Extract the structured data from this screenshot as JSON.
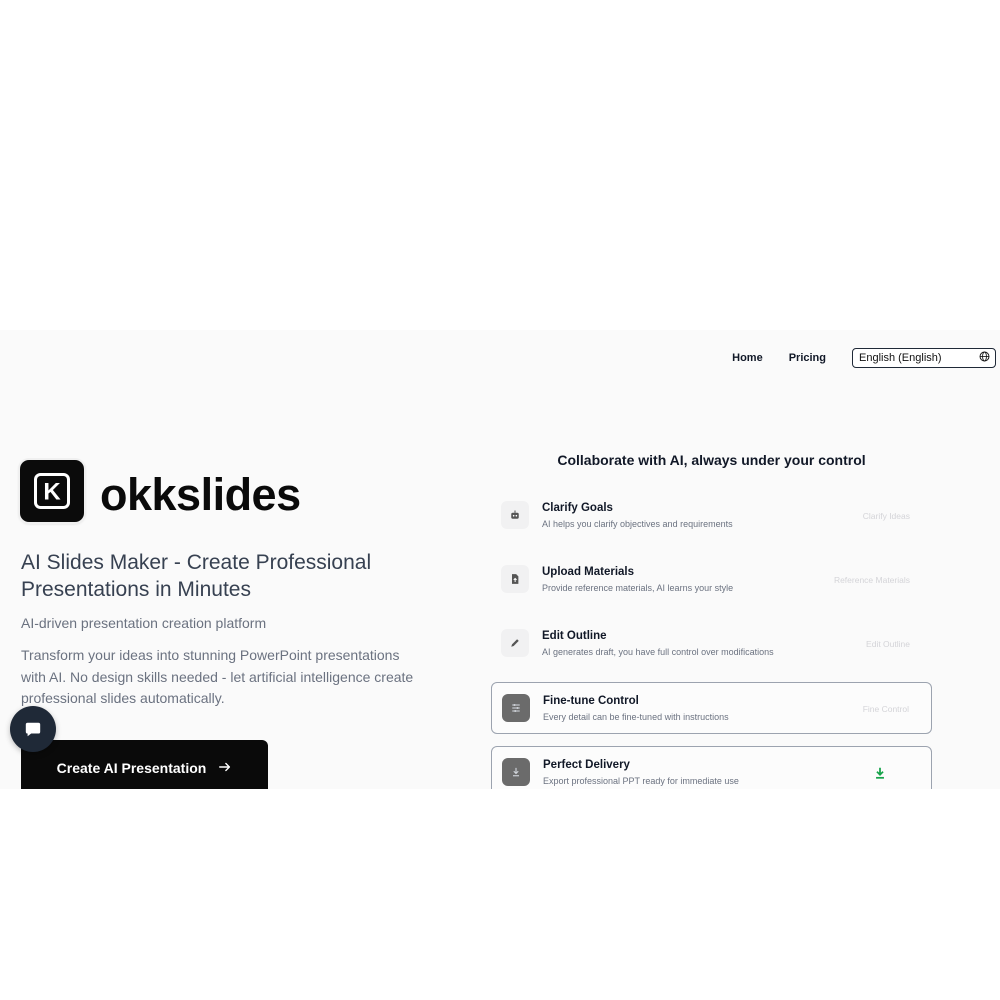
{
  "nav": {
    "home": "Home",
    "pricing": "Pricing",
    "language": "English (English)"
  },
  "hero": {
    "brand": "okkslides",
    "logo_letter": "K",
    "title": "AI Slides Maker - Create Professional Presentations in Minutes",
    "subtitle": "AI-driven presentation creation platform",
    "description": "Transform your ideas into stunning PowerPoint presentations with AI. No design skills needed - let artificial intelligence create professional slides automatically.",
    "cta": "Create AI Presentation"
  },
  "workflow": {
    "title": "Collaborate with AI, always under your control",
    "steps": [
      {
        "name": "Clarify Goals",
        "desc": "AI helps you clarify objectives and requirements",
        "tag": "Clarify Ideas",
        "icon": "robot-icon",
        "active": false
      },
      {
        "name": "Upload Materials",
        "desc": "Provide reference materials, AI learns your style",
        "tag": "Reference Materials",
        "icon": "file-upload-icon",
        "active": false
      },
      {
        "name": "Edit Outline",
        "desc": "AI generates draft, you have full control over modifications",
        "tag": "Edit Outline",
        "icon": "pencil-icon",
        "active": false
      },
      {
        "name": "Fine-tune Control",
        "desc": "Every detail can be fine-tuned with instructions",
        "tag": "Fine Control",
        "icon": "sliders-icon",
        "active": true
      },
      {
        "name": "Perfect Delivery",
        "desc": "Export professional PPT ready for immediate use",
        "tag": "",
        "icon": "download-icon",
        "active": true
      }
    ]
  },
  "colors": {
    "accent": "#0a0a0a",
    "download_status": "#16a34a"
  }
}
